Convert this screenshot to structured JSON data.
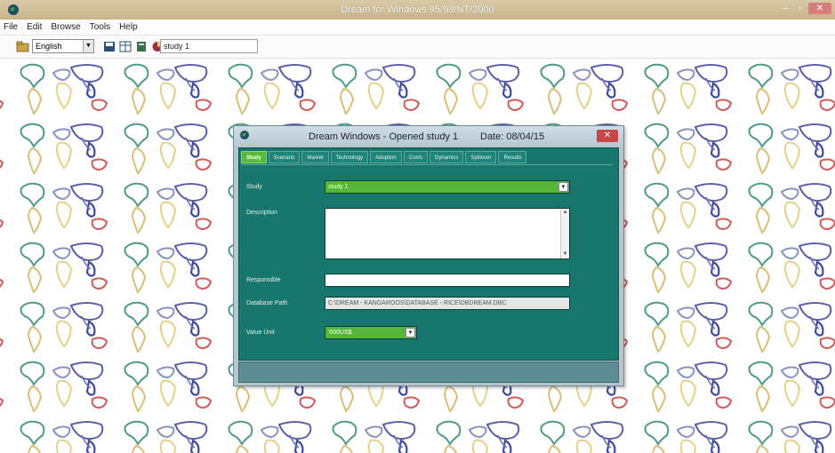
{
  "app": {
    "title": "Dream for Windows 95/98/NT/2000",
    "window_buttons": {
      "minimize": "–",
      "maximize": "▫",
      "close": "✕"
    }
  },
  "menu": [
    "File",
    "Edit",
    "Browse",
    "Tools",
    "Help"
  ],
  "toolbar": {
    "language": "English",
    "study": "study 1",
    "icons": [
      "open-folder-icon",
      "save-icon",
      "table-icon",
      "grid-icon",
      "chart-icon",
      "world-icon"
    ]
  },
  "dialog": {
    "title": "Dream Windows - Opened study 1",
    "date": "Date: 08/04/15",
    "close": "✕",
    "tabs": [
      "Study",
      "Scenario",
      "Market",
      "Technology",
      "Adoption",
      "Costs",
      "Dynamics",
      "Spillover",
      "Results"
    ],
    "active_tab": "Study",
    "fields": {
      "study_label": "Study",
      "study_value": "study 1",
      "description_label": "Description",
      "description_value": "",
      "responsible_label": "Responsible",
      "responsible_value": "",
      "db_path_label": "Database Path",
      "db_path_value": "C:\\DREAM - KANGAROOS\\DATABASE - RICE\\DBDREAM.DBC",
      "value_unit_label": "Value Unit",
      "value_unit_value": "'000US$"
    },
    "dropdown_arrow": "▼",
    "scroll_up": "▲",
    "scroll_down": "▼"
  }
}
